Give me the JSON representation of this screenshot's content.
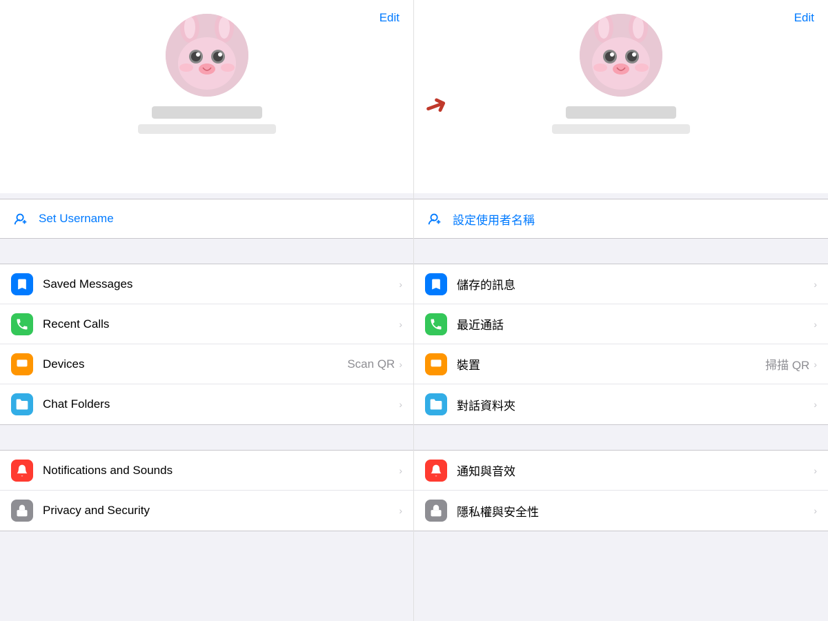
{
  "left": {
    "edit_label": "Edit",
    "username_icon": "👤",
    "username_label": "Set Username",
    "menu_groups": [
      [
        {
          "id": "saved",
          "label": "Saved Messages",
          "icon": "bookmark",
          "icon_color": "blue",
          "secondary": "",
          "has_chevron": true
        },
        {
          "id": "calls",
          "label": "Recent Calls",
          "icon": "phone",
          "icon_color": "green",
          "secondary": "",
          "has_chevron": true
        },
        {
          "id": "devices",
          "label": "Devices",
          "icon": "laptop",
          "icon_color": "orange",
          "secondary": "Scan QR",
          "has_chevron": true
        },
        {
          "id": "folders",
          "label": "Chat Folders",
          "icon": "folder",
          "icon_color": "cyan",
          "secondary": "",
          "has_chevron": true
        }
      ],
      [
        {
          "id": "notifications",
          "label": "Notifications and Sounds",
          "icon": "bell",
          "icon_color": "red",
          "secondary": "",
          "has_chevron": true
        },
        {
          "id": "privacy",
          "label": "Privacy and Security",
          "icon": "lock",
          "icon_color": "gray",
          "secondary": "",
          "has_chevron": true
        }
      ]
    ]
  },
  "right": {
    "edit_label": "Edit",
    "username_icon": "👤",
    "username_label": "設定使用者名稱",
    "menu_groups": [
      [
        {
          "id": "saved",
          "label": "儲存的訊息",
          "icon": "bookmark",
          "icon_color": "blue",
          "secondary": "",
          "has_chevron": true
        },
        {
          "id": "calls",
          "label": "最近通話",
          "icon": "phone",
          "icon_color": "green",
          "secondary": "",
          "has_chevron": true
        },
        {
          "id": "devices",
          "label": "裝置",
          "icon": "laptop",
          "icon_color": "orange",
          "secondary": "掃描 QR",
          "has_chevron": true
        },
        {
          "id": "folders",
          "label": "對話資料夾",
          "icon": "folder",
          "icon_color": "cyan",
          "secondary": "",
          "has_chevron": true
        }
      ],
      [
        {
          "id": "notifications",
          "label": "通知與音效",
          "icon": "bell",
          "icon_color": "red",
          "secondary": "",
          "has_chevron": true
        },
        {
          "id": "privacy",
          "label": "隱私權與安全性",
          "icon": "lock",
          "icon_color": "gray",
          "secondary": "",
          "has_chevron": true
        }
      ]
    ]
  }
}
